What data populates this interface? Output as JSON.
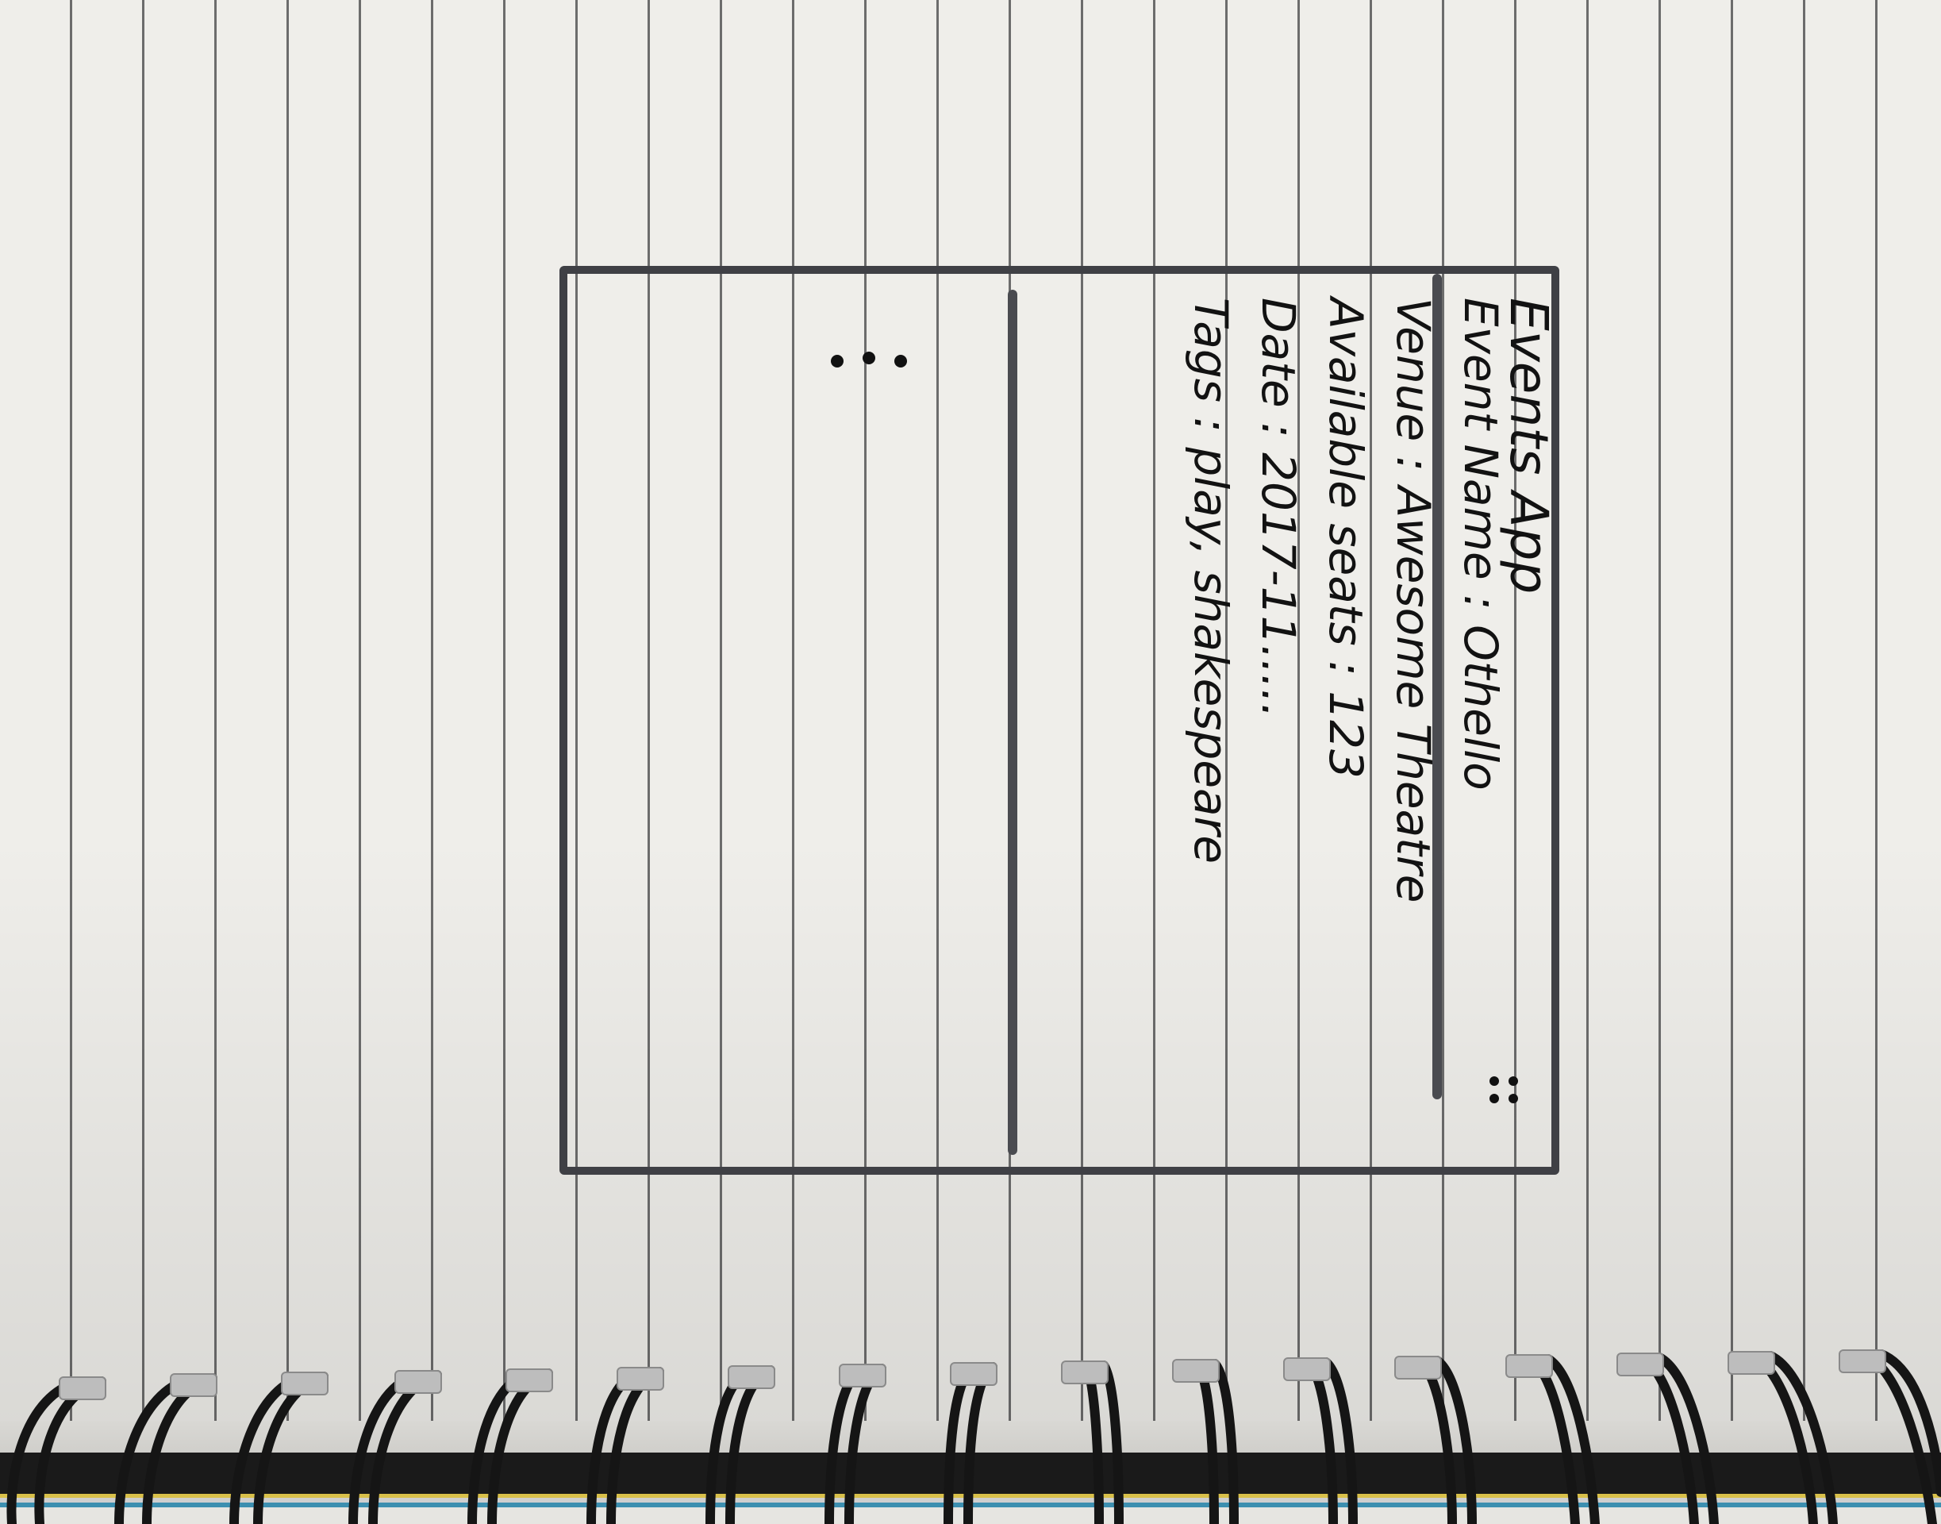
{
  "app": {
    "title": "Events App",
    "menu_icon": "overflow-menu-icon"
  },
  "event": {
    "name_label": "Event Name",
    "name": "Othello",
    "venue_label": "Venue",
    "venue": "Awesome Theatre",
    "seats_label": "Available seats",
    "seats": "123",
    "date_label": "Date",
    "date": "2017-11.....",
    "tags_label": "Tags",
    "tags": "play, shakespeare"
  },
  "list": {
    "more_icon": "ellipsis-icon"
  }
}
